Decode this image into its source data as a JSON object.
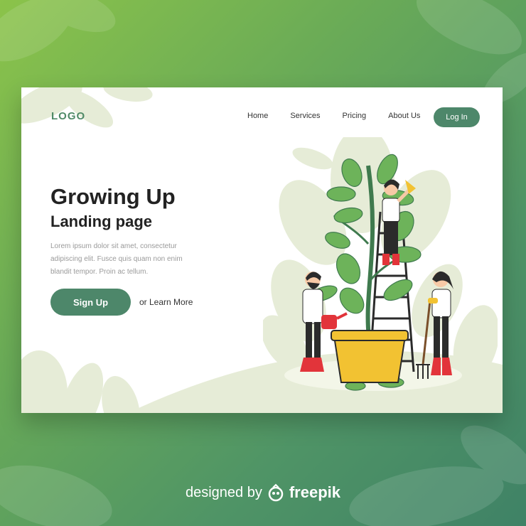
{
  "header": {
    "logo": "LOGO",
    "nav": [
      "Home",
      "Services",
      "Pricing",
      "About Us"
    ],
    "login_label": "Log In"
  },
  "hero": {
    "title": "Growing Up",
    "subtitle": "Landing page",
    "description": "Lorem ipsum dolor sit amet, consectetur adipiscing elit. Fusce quis quam non enim blandit tempor. Proin ac tellum.",
    "signup_label": "Sign Up",
    "learn_more_label": "or Learn More"
  },
  "footer_credit": {
    "prefix": "designed by",
    "brand": "freepik"
  },
  "colors": {
    "accent": "#4d876a",
    "pale_leaf": "#e6ecd7",
    "plant_green": "#6db35a",
    "pot_yellow": "#f2c232",
    "boots_red": "#e2343a"
  },
  "icons": [
    "freepik-logo-icon",
    "plant-illustration"
  ]
}
